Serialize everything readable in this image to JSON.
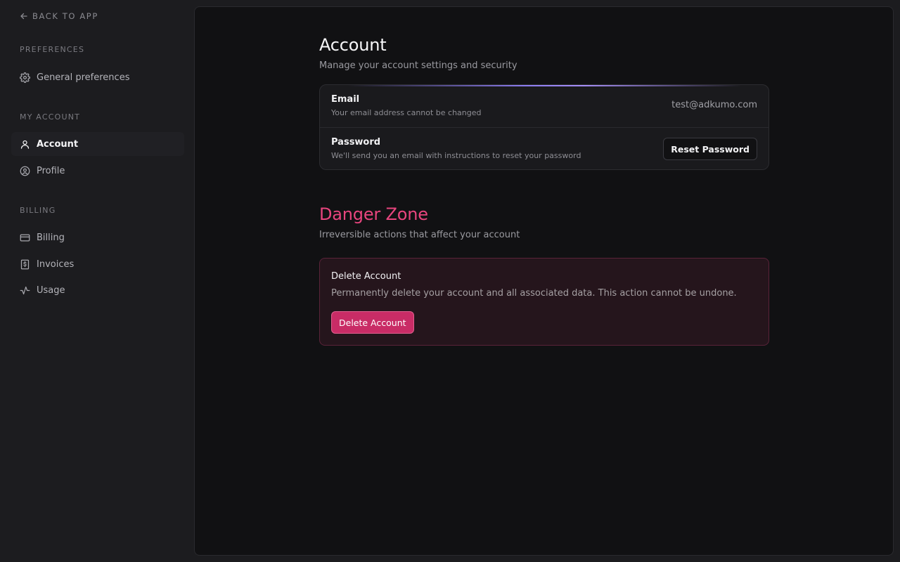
{
  "sidebar": {
    "back_label": "BACK TO APP",
    "sections": [
      {
        "label": "PREFERENCES"
      },
      {
        "label": "MY ACCOUNT"
      },
      {
        "label": "BILLING"
      }
    ],
    "items": {
      "general": {
        "label": "General preferences",
        "icon": "gear-icon"
      },
      "account": {
        "label": "Account",
        "icon": "user-icon",
        "active": true
      },
      "profile": {
        "label": "Profile",
        "icon": "user-circle-icon"
      },
      "billing": {
        "label": "Billing",
        "icon": "credit-card-icon"
      },
      "invoices": {
        "label": "Invoices",
        "icon": "receipt-dollar-icon"
      },
      "usage": {
        "label": "Usage",
        "icon": "activity-icon"
      }
    }
  },
  "account": {
    "title": "Account",
    "subtitle": "Manage your account settings and security",
    "email": {
      "title": "Email",
      "description": "Your email address cannot be changed",
      "value": "test@adkumo.com"
    },
    "password": {
      "title": "Password",
      "description": "We'll send you an email with instructions to reset your password",
      "button_label": "Reset Password"
    }
  },
  "danger_zone": {
    "title": "Danger Zone",
    "subtitle": "Irreversible actions that affect your account",
    "card_title": "Delete Account",
    "card_description": "Permanently delete your account and all associated data. This action cannot be undone.",
    "button_label": "Delete Account"
  },
  "colors": {
    "danger_accent": "#e8457e",
    "danger_button": "#c92c66",
    "glow_accent": "#8b7cf0"
  }
}
